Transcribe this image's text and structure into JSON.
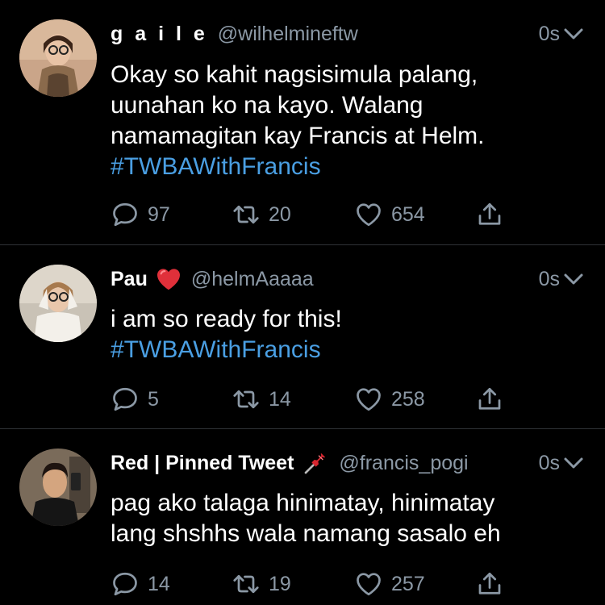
{
  "tweets": [
    {
      "name": "g a i l e",
      "handle": "@wilhelmineftw",
      "time": "0s",
      "lines": [
        "Okay so kahit nagsisimula palang,",
        "uunahan ko na kayo. Walang",
        "namamagitan kay Francis at Helm."
      ],
      "hashtag": "#TWBAWithFrancis",
      "replies": "97",
      "retweets": "20",
      "likes": "654"
    },
    {
      "name": "Pau",
      "emoji": "red-heart",
      "handle": "@helmAaaaa",
      "time": "0s",
      "lines": [
        "i am so ready for this!"
      ],
      "hashtag": "#TWBAWithFrancis",
      "replies": "5",
      "retweets": "14",
      "likes": "258"
    },
    {
      "name": "Red | Pinned Tweet",
      "emoji": "pushpin",
      "handle": "@francis_pogi",
      "time": "0s",
      "lines": [
        "pag ako talaga hinimatay, hinimatay",
        "lang shshhs wala namang sasalo eh"
      ],
      "replies": "14",
      "retweets": "19",
      "likes": "257"
    }
  ],
  "icons": [
    "reply-icon",
    "retweet-icon",
    "like-icon",
    "share-icon",
    "chevron-down-icon"
  ],
  "colors": {
    "background": "#000000",
    "text": "#ffffff",
    "muted": "#8b98a5",
    "hashtag": "#4a9fe3",
    "divider": "#2f3336"
  }
}
